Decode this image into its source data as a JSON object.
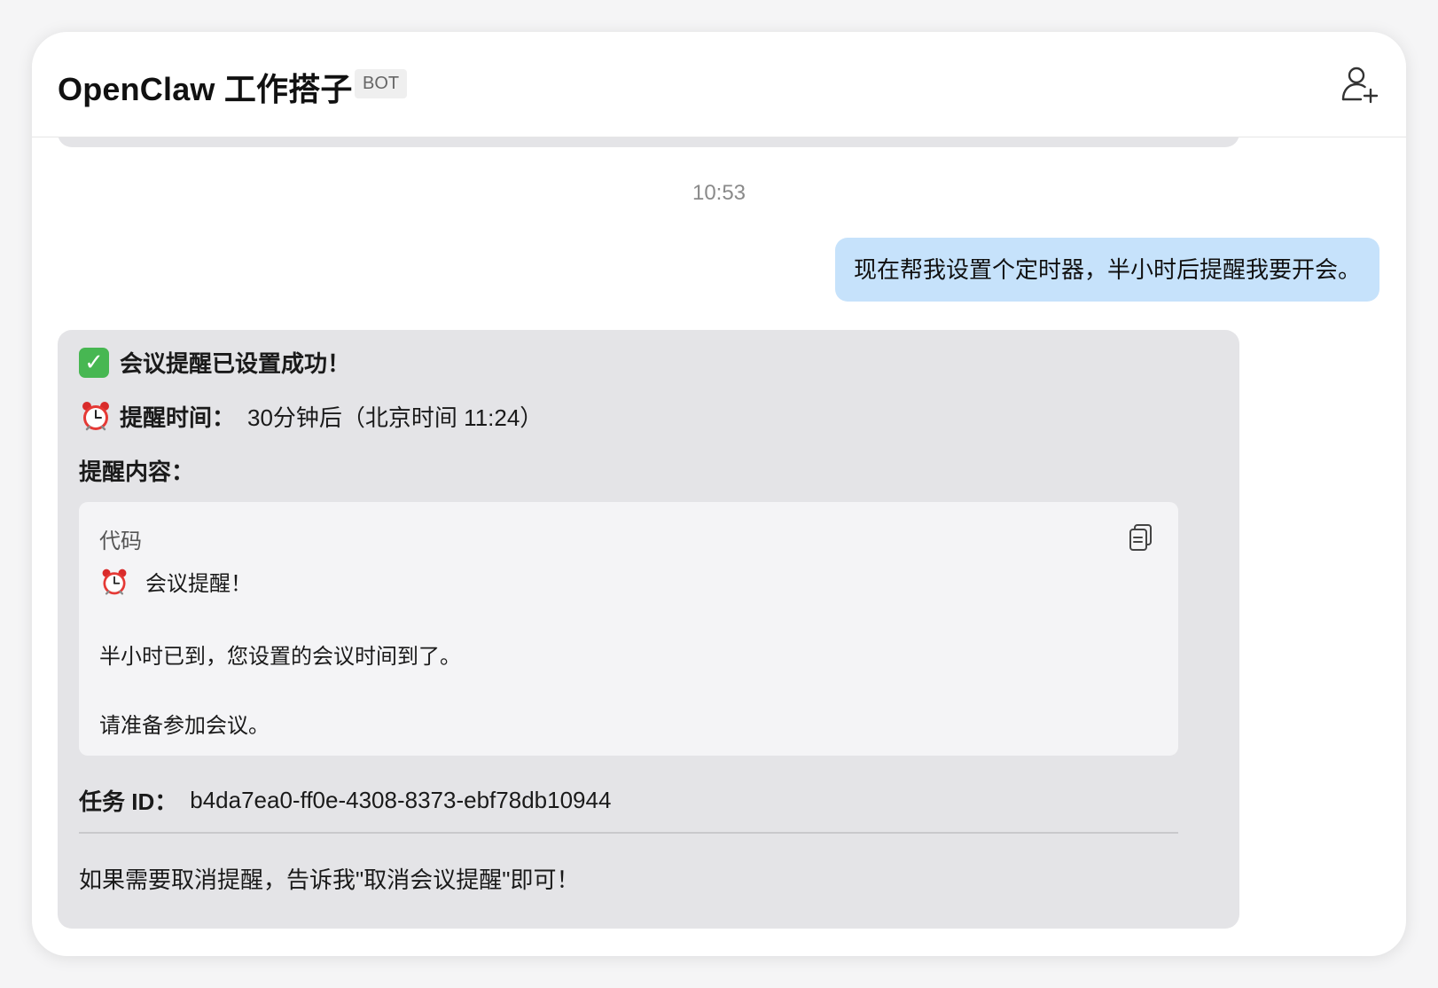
{
  "header": {
    "title": "OpenClaw 工作搭子",
    "badge": "BOT"
  },
  "chat": {
    "timestamp": "10:53",
    "user_message": "现在帮我设置个定时器，半小时后提醒我要开会。",
    "bot_message": {
      "success_title": "会议提醒已设置成功！",
      "time_label": "提醒时间：",
      "time_value": "30分钟后（北京时间 11:24）",
      "content_label": "提醒内容：",
      "code_block": {
        "label": "代码",
        "line1": "会议提醒！",
        "line2": "半小时已到，您设置的会议时间到了。",
        "line3": "请准备参加会议。"
      },
      "task_label": "任务 ID：",
      "task_value": "b4da7ea0-ff0e-4308-8373-ebf78db10944",
      "footer": "如果需要取消提醒，告诉我\"取消会议提醒\"即可！"
    }
  },
  "icons": {
    "add_member": "add-member-icon",
    "check": "check-mark-emoji-icon",
    "clock": "alarm-clock-emoji-icon",
    "copy": "copy-icon"
  },
  "colors": {
    "user_bubble": "#c6e2fb",
    "bot_bubble": "#e4e4e7",
    "code_block": "#f4f4f6",
    "check_green": "#47b752"
  }
}
